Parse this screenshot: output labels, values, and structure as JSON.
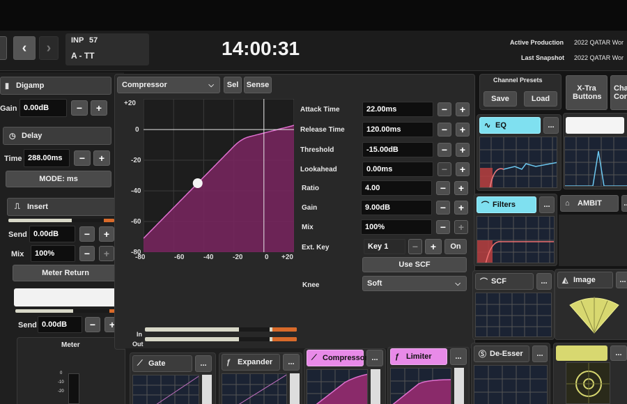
{
  "header": {
    "input_label": "INP",
    "input_number": "57",
    "channel_name": "A - TT",
    "clock": "14:00:31",
    "active_production_label": "Active Production",
    "active_production_value": "2022 QATAR Wor",
    "last_snapshot_label": "Last Snapshot",
    "last_snapshot_value": "2022 QATAR Wor"
  },
  "left": {
    "digamp_title": "Digamp",
    "gain_label": "Gain",
    "gain_value": "0.00dB",
    "delay_title": "Delay",
    "time_label": "Time",
    "time_value": "288.00ms",
    "mode_label": "MODE: ms",
    "insert_title": "Insert",
    "send_label": "Send",
    "send_value": "0.00dB",
    "mix_label": "Mix",
    "mix_value": "100%",
    "meter_return_label": "Meter Return",
    "aux_send_label": "Send",
    "aux_send_value": "0.00dB",
    "meter_title": "Meter",
    "meter_scale": [
      "0",
      "-10",
      "-20"
    ]
  },
  "compressor": {
    "type_label": "Compressor",
    "sel_label": "Sel",
    "sense_label": "Sense",
    "y_ticks": [
      "+20",
      "0",
      "-20",
      "-40",
      "-60",
      "-80"
    ],
    "x_ticks": [
      "-80",
      "-60",
      "-40",
      "-20",
      "0",
      "+20"
    ],
    "in_label": "In",
    "out_label": "Out",
    "in_level": 0.82,
    "out_level": 0.82,
    "params": [
      {
        "label": "Attack Time",
        "value": "22.00ms"
      },
      {
        "label": "Release Time",
        "value": "120.00ms"
      },
      {
        "label": "Threshold",
        "value": "-15.00dB"
      },
      {
        "label": "Lookahead",
        "value": "0.00ms"
      },
      {
        "label": "Ratio",
        "value": "4.00"
      },
      {
        "label": "Gain",
        "value": "9.00dB"
      },
      {
        "label": "Mix",
        "value": "100%"
      }
    ],
    "ext_key_label": "Ext. Key",
    "ext_key_value": "Key 1",
    "ext_key_on": "On",
    "use_scf_label": "Use SCF",
    "knee_label": "Knee",
    "knee_value": "Soft",
    "curve": {
      "threshold_db": -15,
      "ratio": 4,
      "makeup_db": 9,
      "point_input_db": -44,
      "axis_min": -80,
      "axis_max": 20
    }
  },
  "right": {
    "channel_presets_title": "Channel Presets",
    "save_label": "Save",
    "load_label": "Load",
    "xtra_label": "X-Tra Buttons",
    "chan_con_label": "Cha Con",
    "eq_label": "EQ",
    "filters_label": "Filters",
    "ambit_label": "AMBIT",
    "scf_label": "SCF",
    "image_label": "Image",
    "more_label": "..."
  },
  "bottom": {
    "gate_label": "Gate",
    "expander_label": "Expander",
    "compressor_label": "Compressor",
    "limiter_label": "Limiter",
    "deesser_label": "De-Esser"
  },
  "colors": {
    "accent_pink": "#e88ae8",
    "accent_cyan": "#7fe0f0",
    "curve_fill": "#8a2a6a",
    "peak_orange": "#d86a2a",
    "image_yellow": "#d8d870"
  }
}
